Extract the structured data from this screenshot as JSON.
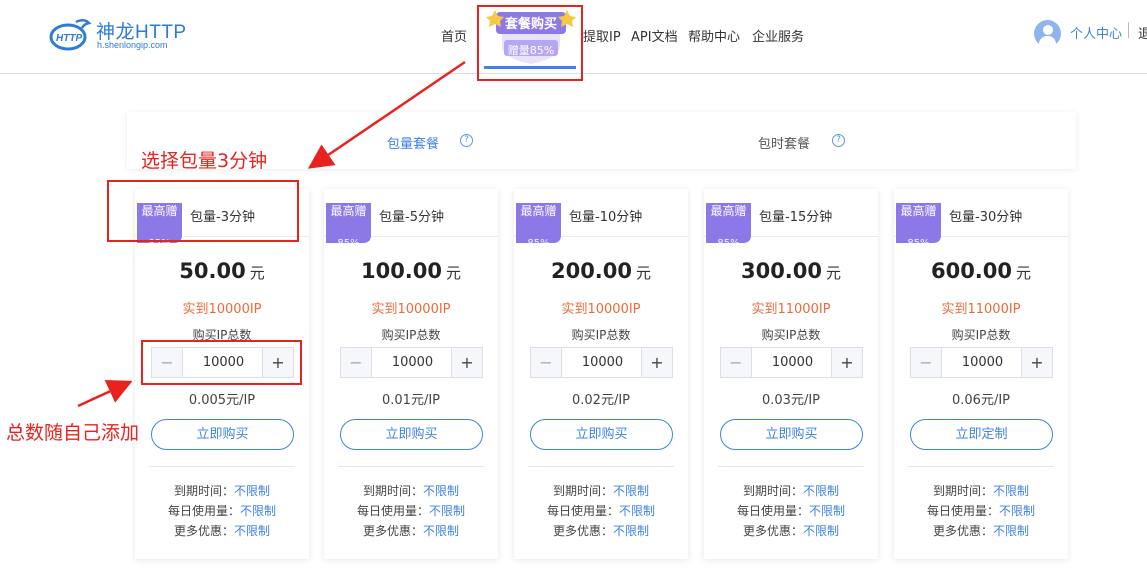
{
  "header": {
    "logo_name": "神龙HTTP",
    "logo_domain": "h.shenlongip.com",
    "logo_mark_text": "HTTP",
    "nav": [
      {
        "label": "首页"
      },
      {
        "label": "提取IP"
      },
      {
        "label": "API文档"
      },
      {
        "label": "帮助中心"
      },
      {
        "label": "企业服务"
      }
    ],
    "badge": {
      "title": "套餐购买",
      "subtitle": "赠量85%"
    },
    "user_center": "个人中心",
    "logout": "退"
  },
  "tabs": {
    "package_by_volume": "包量套餐",
    "package_by_time": "包时套餐",
    "help_glyph": "?"
  },
  "cards": [
    {
      "ribbon": "最高赠",
      "ribbon_sub": "85%",
      "name": "包量-3分钟",
      "price": "50.00",
      "price_unit": "元",
      "actual": "实到10000IP",
      "buy_label": "购买IP总数",
      "quantity": "10000",
      "unit_price": "0.005元/IP",
      "button": "立即购买",
      "expire_label": "到期时间：",
      "expire_value": "不限制",
      "daily_label": "每日使用量：",
      "daily_value": "不限制",
      "more_label": "更多优惠：",
      "more_value": "不限制"
    },
    {
      "ribbon": "最高赠",
      "ribbon_sub": "85%",
      "name": "包量-5分钟",
      "price": "100.00",
      "price_unit": "元",
      "actual": "实到10000IP",
      "buy_label": "购买IP总数",
      "quantity": "10000",
      "unit_price": "0.01元/IP",
      "button": "立即购买",
      "expire_label": "到期时间：",
      "expire_value": "不限制",
      "daily_label": "每日使用量：",
      "daily_value": "不限制",
      "more_label": "更多优惠：",
      "more_value": "不限制"
    },
    {
      "ribbon": "最高赠",
      "ribbon_sub": "85%",
      "name": "包量-10分钟",
      "price": "200.00",
      "price_unit": "元",
      "actual": "实到10000IP",
      "buy_label": "购买IP总数",
      "quantity": "10000",
      "unit_price": "0.02元/IP",
      "button": "立即购买",
      "expire_label": "到期时间：",
      "expire_value": "不限制",
      "daily_label": "每日使用量：",
      "daily_value": "不限制",
      "more_label": "更多优惠：",
      "more_value": "不限制"
    },
    {
      "ribbon": "最高赠",
      "ribbon_sub": "85%",
      "name": "包量-15分钟",
      "price": "300.00",
      "price_unit": "元",
      "actual": "实到11000IP",
      "buy_label": "购买IP总数",
      "quantity": "10000",
      "unit_price": "0.03元/IP",
      "button": "立即购买",
      "expire_label": "到期时间：",
      "expire_value": "不限制",
      "daily_label": "每日使用量：",
      "daily_value": "不限制",
      "more_label": "更多优惠：",
      "more_value": "不限制"
    },
    {
      "ribbon": "最高赠",
      "ribbon_sub": "85%",
      "name": "包量-30分钟",
      "price": "600.00",
      "price_unit": "元",
      "actual": "实到11000IP",
      "buy_label": "购买IP总数",
      "quantity": "10000",
      "unit_price": "0.06元/IP",
      "button": "立即定制",
      "expire_label": "到期时间：",
      "expire_value": "不限制",
      "daily_label": "每日使用量：",
      "daily_value": "不限制",
      "more_label": "更多优惠：",
      "more_value": "不限制"
    }
  ],
  "stepper_glyphs": {
    "minus": "−",
    "plus": "+"
  },
  "annotations": {
    "select_hint": "选择包量3分钟",
    "quantity_hint": "总数随自己添加"
  },
  "colors": {
    "brand_blue": "#3f82e6",
    "price_orange": "#ef6a3a",
    "ribbon_purple": "#8d78e8",
    "annotation_red": "#e8231f"
  }
}
